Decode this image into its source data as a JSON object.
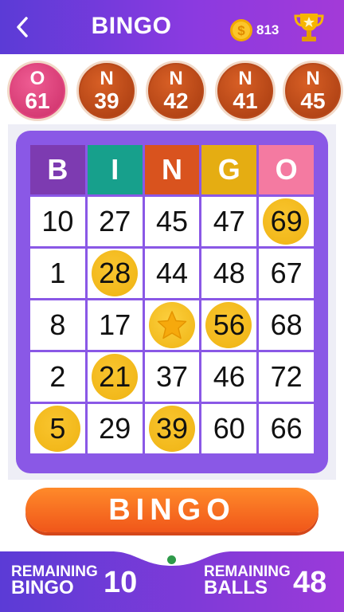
{
  "header": {
    "title": "BINGO",
    "coins": "813",
    "colors": {
      "gradient_start": "#5b3bd6",
      "gradient_end": "#a33ad8"
    },
    "icons": [
      "back-arrow-icon",
      "coin-icon",
      "trophy-icon"
    ]
  },
  "drawn_balls": [
    {
      "letter": "O",
      "number": "61",
      "color": "pink"
    },
    {
      "letter": "N",
      "number": "39",
      "color": "brown"
    },
    {
      "letter": "N",
      "number": "42",
      "color": "brown"
    },
    {
      "letter": "N",
      "number": "41",
      "color": "brown"
    },
    {
      "letter": "N",
      "number": "45",
      "color": "brown"
    }
  ],
  "card": {
    "headers": [
      {
        "letter": "B",
        "color": "#7d3bb1"
      },
      {
        "letter": "I",
        "color": "#17a08c"
      },
      {
        "letter": "N",
        "color": "#d9531e"
      },
      {
        "letter": "G",
        "color": "#e5ad12"
      },
      {
        "letter": "O",
        "color": "#f47aa1"
      }
    ],
    "rows": [
      [
        {
          "v": "10",
          "m": false
        },
        {
          "v": "27",
          "m": false
        },
        {
          "v": "45",
          "m": false
        },
        {
          "v": "47",
          "m": false
        },
        {
          "v": "69",
          "m": true
        }
      ],
      [
        {
          "v": "1",
          "m": false
        },
        {
          "v": "28",
          "m": true
        },
        {
          "v": "44",
          "m": false
        },
        {
          "v": "48",
          "m": false
        },
        {
          "v": "67",
          "m": false
        }
      ],
      [
        {
          "v": "8",
          "m": false
        },
        {
          "v": "17",
          "m": false
        },
        {
          "v": "",
          "m": true,
          "free": true
        },
        {
          "v": "56",
          "m": true
        },
        {
          "v": "68",
          "m": false
        }
      ],
      [
        {
          "v": "2",
          "m": false
        },
        {
          "v": "21",
          "m": true
        },
        {
          "v": "37",
          "m": false
        },
        {
          "v": "46",
          "m": false
        },
        {
          "v": "72",
          "m": false
        }
      ],
      [
        {
          "v": "5",
          "m": true
        },
        {
          "v": "29",
          "m": false
        },
        {
          "v": "39",
          "m": true
        },
        {
          "v": "60",
          "m": false
        },
        {
          "v": "66",
          "m": false
        }
      ]
    ]
  },
  "bingo_button": {
    "label": "BINGO"
  },
  "footer": {
    "remaining_bingo": {
      "line1": "REMAINING",
      "line2": "BINGO",
      "value": "10"
    },
    "remaining_balls": {
      "line1": "REMAINING",
      "line2": "BALLS",
      "value": "48"
    }
  }
}
